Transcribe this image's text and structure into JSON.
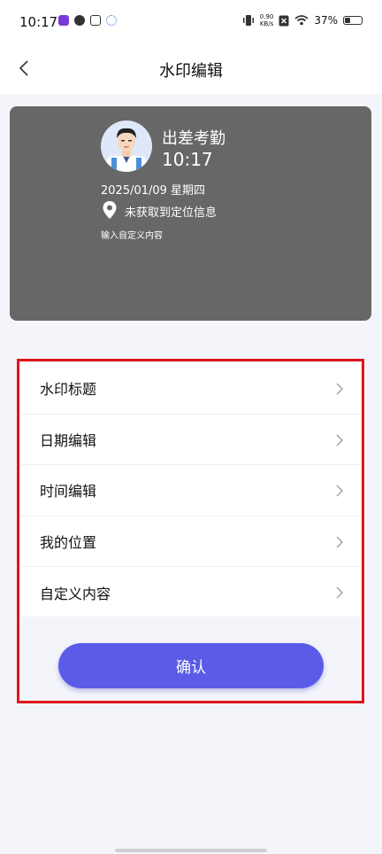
{
  "status_bar": {
    "time": "10:17",
    "net_speed_value": "0.90",
    "net_speed_unit": "KB/s",
    "battery": "37%"
  },
  "header": {
    "title": "水印编辑"
  },
  "preview": {
    "title": "出差考勤",
    "time": "10:17",
    "date": "2025/01/09 星期四",
    "location": "未获取到定位信息",
    "custom": "输入自定义内容"
  },
  "menu": {
    "items": [
      {
        "label": "水印标题"
      },
      {
        "label": "日期编辑"
      },
      {
        "label": "时间编辑"
      },
      {
        "label": "我的位置"
      },
      {
        "label": "自定义内容"
      }
    ]
  },
  "confirm_label": "确认",
  "colors": {
    "accent": "#5b5be7",
    "highlight": "#e0151c",
    "preview_bg": "#676767"
  }
}
